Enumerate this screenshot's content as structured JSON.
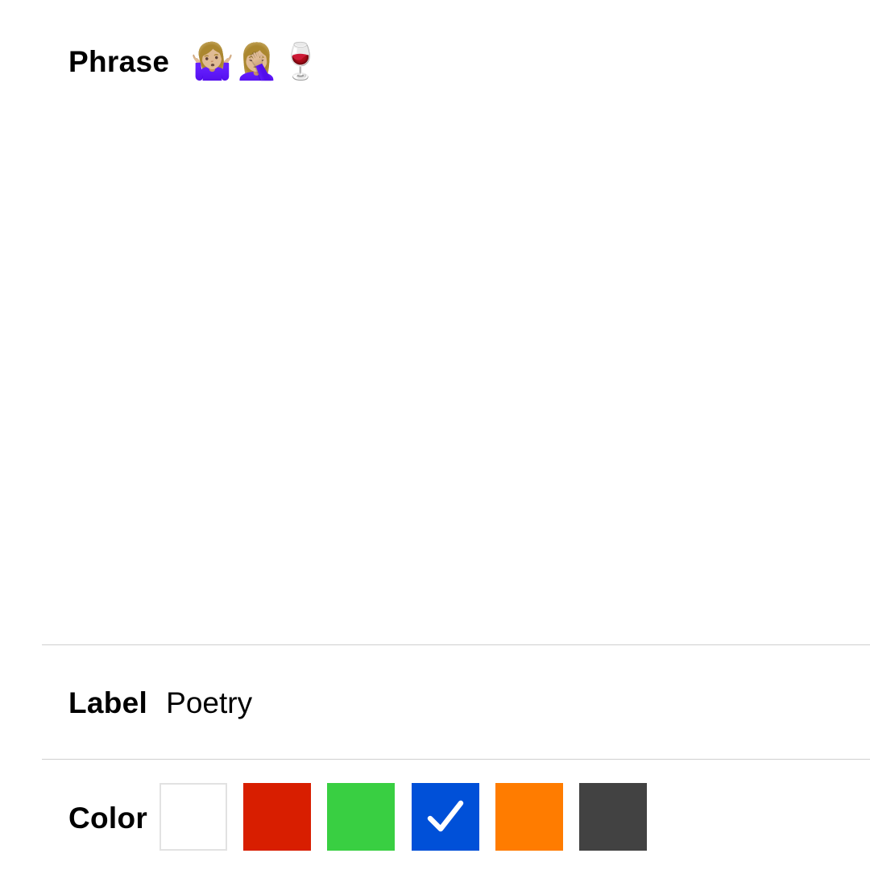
{
  "phrase": {
    "label": "Phrase",
    "value": "🤷🏼‍♀️🤦🏼‍♀️🍷"
  },
  "label_field": {
    "label": "Label",
    "value": "Poetry"
  },
  "color": {
    "label": "Color",
    "selected": "blue",
    "swatches": [
      {
        "name": "white",
        "hex": "#ffffff"
      },
      {
        "name": "red",
        "hex": "#d81e00"
      },
      {
        "name": "green",
        "hex": "#39cf42"
      },
      {
        "name": "blue",
        "hex": "#0050d8"
      },
      {
        "name": "orange",
        "hex": "#ff7c00"
      },
      {
        "name": "dark-gray",
        "hex": "#424242"
      }
    ]
  }
}
